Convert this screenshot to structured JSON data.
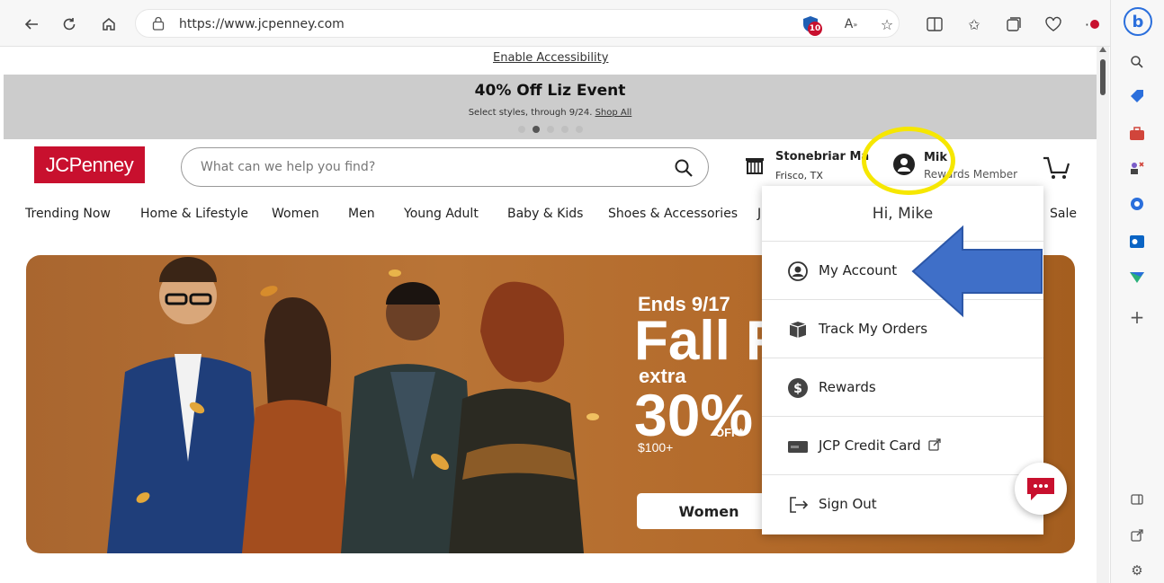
{
  "browser": {
    "url": "https://www.jcpenney.com",
    "tracker_badge": "10"
  },
  "page": {
    "accessibility_link": "Enable Accessibility",
    "promo": {
      "title": "40% Off Liz Event",
      "subtitle": "Select styles, through 9/24.",
      "link": "Shop All"
    },
    "header": {
      "logo": "JCPenney",
      "search_placeholder": "What can we help you find?",
      "store_name": "Stonebriar Ma",
      "store_city": "Frisco, TX",
      "account_name": "Mik",
      "account_status": "Rewards Member"
    },
    "categories": [
      {
        "label": "Trending Now"
      },
      {
        "label": "Home & Lifestyle"
      },
      {
        "label": "Women"
      },
      {
        "label": "Men"
      },
      {
        "label": "Young Adult"
      },
      {
        "label": "Baby & Kids"
      },
      {
        "label": "Shoes & Accessories"
      },
      {
        "label": "J"
      },
      {
        "label": "Sale"
      }
    ],
    "hero": {
      "ends": "Ends 9/17",
      "headline": "Fall F",
      "extra": "extra",
      "percent": "30%",
      "off": "OFF*",
      "minimum": "$100+",
      "button": "Women"
    },
    "account_menu": {
      "greeting": "Hi, Mike",
      "items": [
        {
          "label": "My Account",
          "icon": "account-circle-icon"
        },
        {
          "label": "Track My Orders",
          "icon": "package-icon"
        },
        {
          "label": "Rewards",
          "icon": "dollar-icon"
        },
        {
          "label": "JCP Credit Card",
          "icon": "credit-card-icon"
        },
        {
          "label": "Sign Out",
          "icon": "sign-out-icon"
        }
      ]
    }
  },
  "colors": {
    "brand_red": "#c8102e",
    "highlight_yellow": "#f6e700",
    "annotation_blue": "#3f6fc8",
    "promo_gray": "#cccccc"
  }
}
